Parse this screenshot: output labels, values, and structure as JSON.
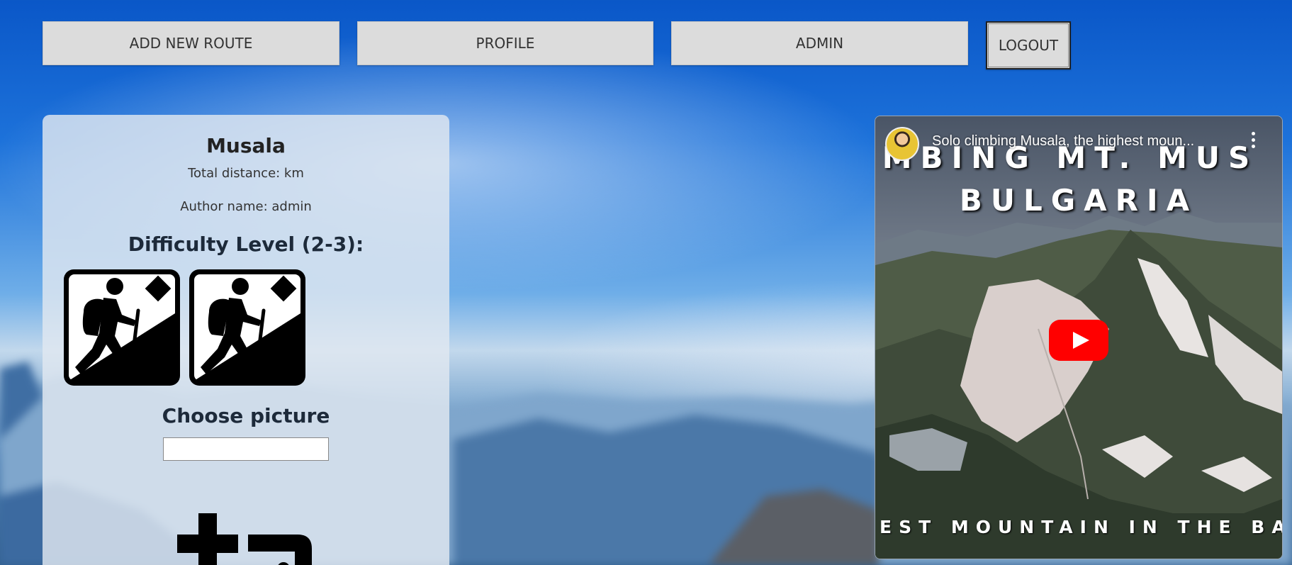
{
  "nav": {
    "add_new_route": "ADD NEW ROUTE",
    "profile": "PROFILE",
    "admin": "ADMIN",
    "logout": "LOGOUT"
  },
  "route": {
    "name": "Musala",
    "total_distance": "Total distance: km",
    "author": "Author name: admin",
    "difficulty_label": "Difficulty Level (2-3):",
    "difficulty_icons": [
      "hiker-icon",
      "hiker-icon"
    ],
    "choose_picture": "Choose picture",
    "upload_icon": "add-photo-icon"
  },
  "video": {
    "title": "Solo climbing Musala, the highest moun...",
    "overlay_line1": "MBING MT. MUS",
    "overlay_line2": "BULGARIA",
    "overlay_bottom": "EST MOUNTAIN IN THE BA",
    "play_icon": "youtube-play-icon",
    "menu_icon": "more-vert-icon",
    "channel_avatar": "channel-avatar"
  },
  "colors": {
    "button_bg": "#dcdcdc",
    "card_bg": "#e1e8f0",
    "play_red": "#ff0000"
  }
}
